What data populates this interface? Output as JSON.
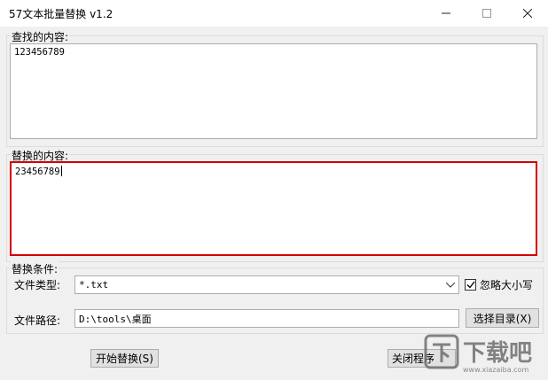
{
  "window": {
    "title": "57文本批量替换 v1.2"
  },
  "find": {
    "label": "查找的内容:",
    "value": "123456789"
  },
  "replace": {
    "label": "替换的内容:",
    "value": "23456789"
  },
  "conditions": {
    "label": "替换条件:",
    "file_type_label": "文件类型:",
    "file_type_value": "*.txt",
    "ignore_case_label": "忽略大小写",
    "ignore_case_checked": true,
    "file_path_label": "文件路径:",
    "file_path_value": "D:\\tools\\桌面",
    "choose_dir_label": "选择目录(X)"
  },
  "buttons": {
    "start_label": "开始替换(S)",
    "close_label": "关闭程序"
  },
  "watermark": {
    "text": "下载吧",
    "domain": "www.xiazaiba.com"
  },
  "colors": {
    "highlight": "#d40000",
    "window_bg": "#f0f0f0"
  }
}
